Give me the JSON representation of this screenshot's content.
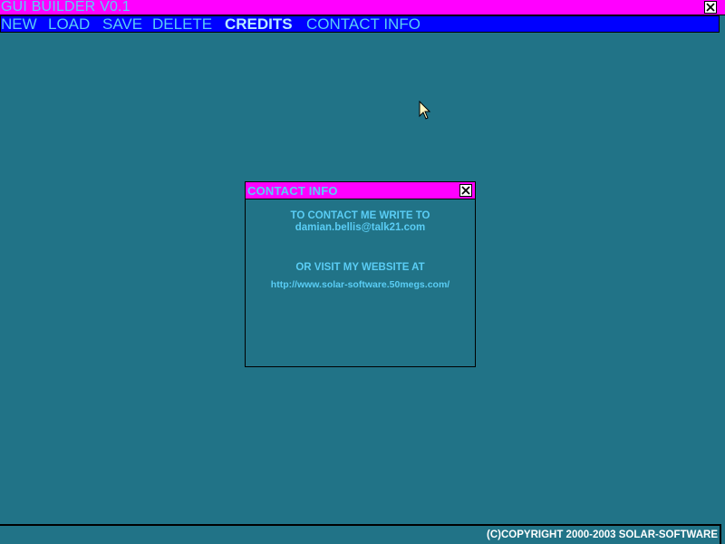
{
  "app": {
    "title": "GUI BUILDER V0.1"
  },
  "menu": {
    "items": [
      {
        "label": "NEW"
      },
      {
        "label": "LOAD"
      },
      {
        "label": "SAVE"
      },
      {
        "label": "DELETE"
      },
      {
        "label": "CREDITS",
        "active": true
      },
      {
        "label": "CONTACT INFO"
      }
    ]
  },
  "dialog": {
    "title": "CONTACT INFO",
    "line1": "TO CONTACT ME WRITE TO",
    "email": "damian.bellis@talk21.com",
    "line2": "OR VISIT MY WEBSITE AT",
    "url": "http://www.solar-software.50megs.com/"
  },
  "footer": {
    "copyright": "(C)COPYRIGHT 2000-2003 SOLAR-SOFTWARE"
  },
  "icons": {
    "close": "close-icon",
    "cursor": "mouse-pointer-icon"
  },
  "colors": {
    "desktop": "#217387",
    "title_bar": "#ff00ff",
    "menu_bar": "#0000ff",
    "text": "#5acdf5"
  }
}
